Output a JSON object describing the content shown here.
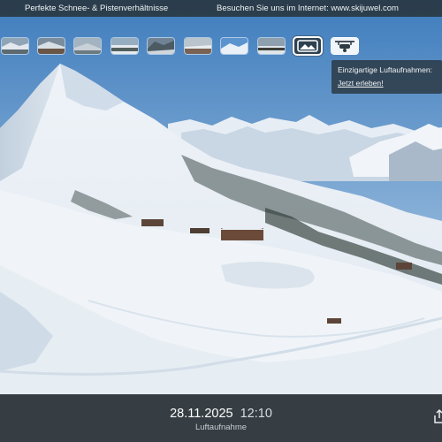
{
  "topbar": {
    "left_text": "Perfekte Schnee- & Pistenverhältnisse",
    "right_text": "Besuchen Sie uns im Internet: www.skijuwel.com"
  },
  "thumbnails": [
    {
      "name": "thumb-view-1",
      "icon": "camera-view"
    },
    {
      "name": "thumb-view-2",
      "icon": "camera-view"
    },
    {
      "name": "thumb-view-3",
      "icon": "camera-view"
    },
    {
      "name": "thumb-view-4",
      "icon": "camera-view"
    },
    {
      "name": "thumb-view-5",
      "icon": "camera-view"
    },
    {
      "name": "thumb-view-6",
      "icon": "camera-view"
    },
    {
      "name": "thumb-view-7",
      "icon": "camera-view"
    },
    {
      "name": "thumb-view-8",
      "icon": "camera-view"
    },
    {
      "name": "thumb-panorama",
      "icon": "panorama-icon",
      "selected": true
    },
    {
      "name": "thumb-drone",
      "icon": "drone-icon"
    }
  ],
  "tooltip": {
    "line1": "Einzigartige Luftaufnahmen:",
    "link": "Jetzt erleben!"
  },
  "footer": {
    "date": "28.11.2025",
    "time": "12:10",
    "caption": "Luftaufnahme"
  },
  "icons": {
    "corner": "share-icon"
  },
  "colors": {
    "sky_top": "#4f86c0",
    "sky_horizon": "#d6e4f0",
    "snow": "#f4f8fb",
    "bar_background": "#2a343c"
  }
}
